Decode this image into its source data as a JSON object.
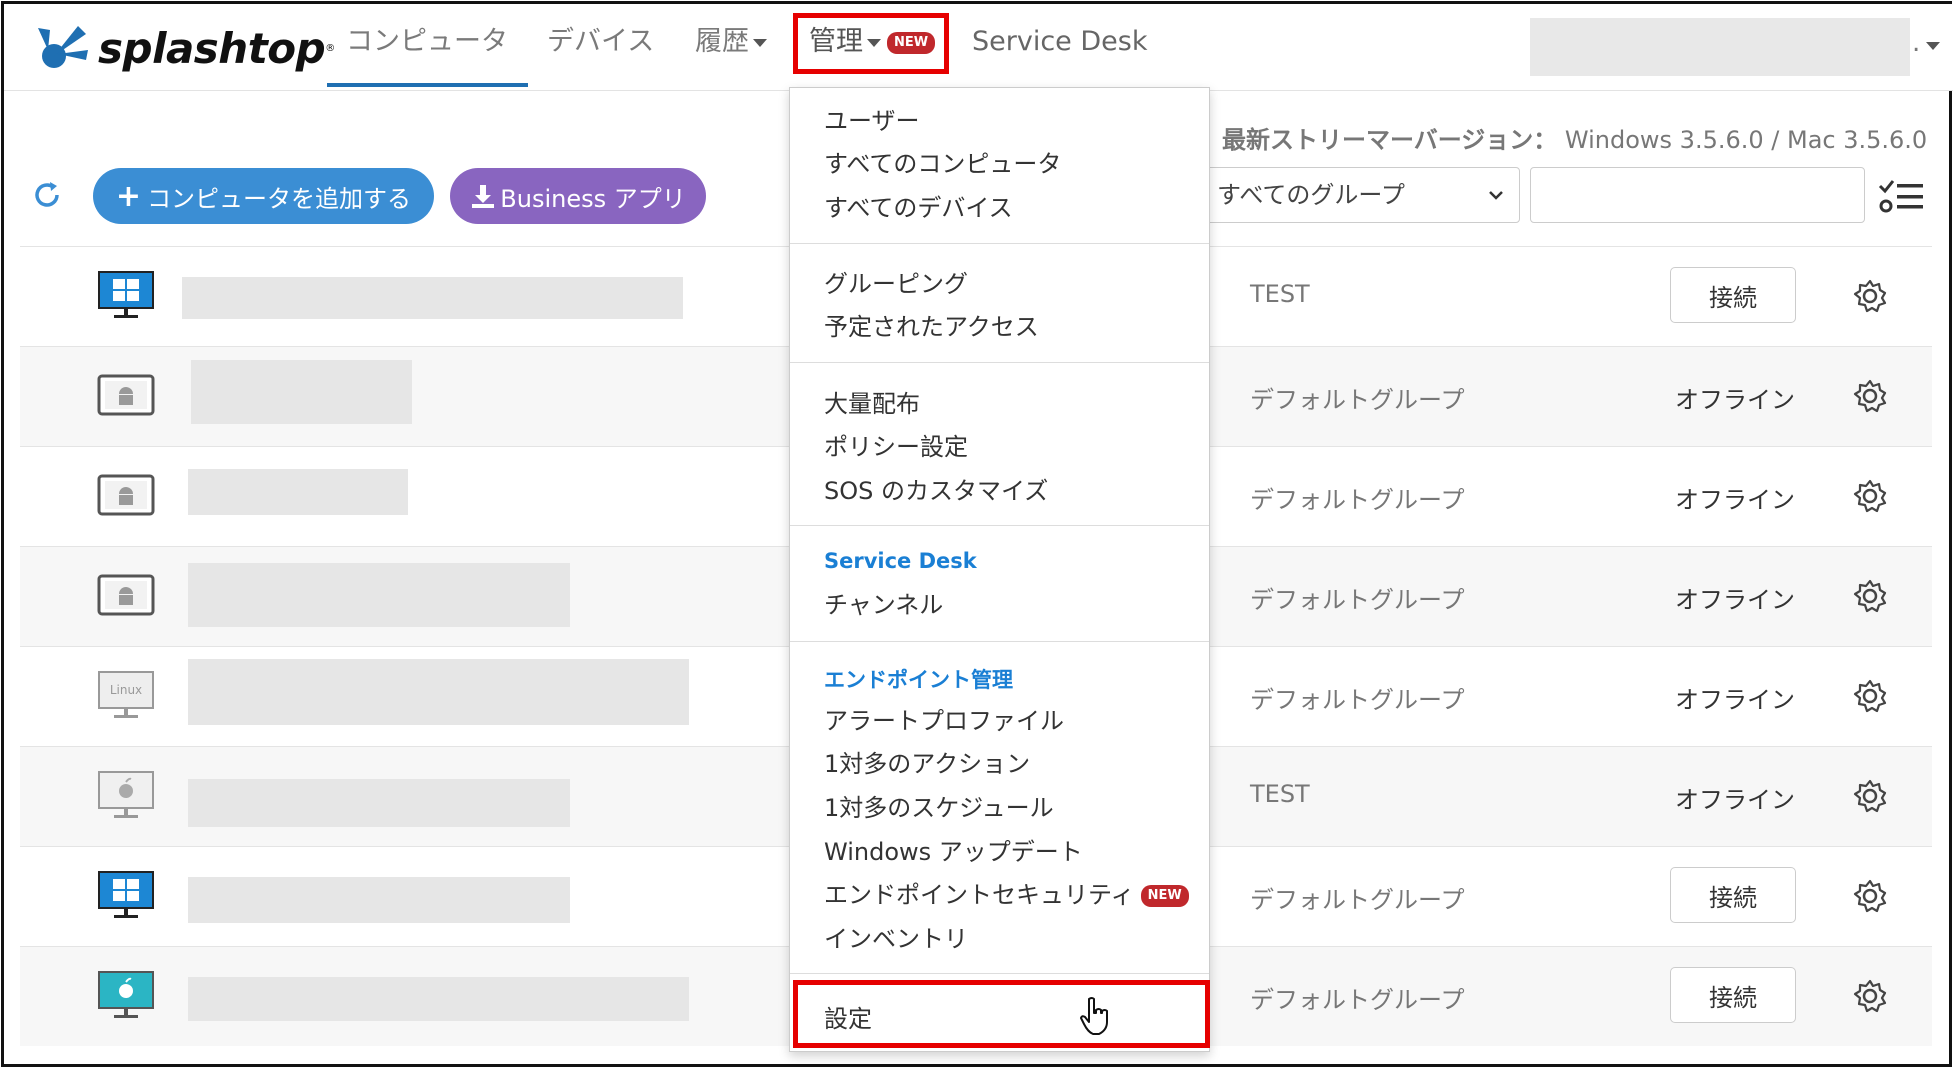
{
  "brand": {
    "name": "splashtop",
    "reg": "®"
  },
  "nav": {
    "computers": "コンピュータ",
    "devices": "デバイス",
    "history": "履歴",
    "management": "管理",
    "new_badge": "NEW",
    "service_desk": "Service Desk",
    "user_suffix": "."
  },
  "toolbar": {
    "add_computer": "コンピュータを追加する",
    "business_app": "Business アプリ",
    "stream_label": "最新ストリーマーバージョン：",
    "stream_versions": "Windows 3.5.6.0 / Mac 3.5.6.0",
    "group_select": "すべてのグループ",
    "search_placeholder": ""
  },
  "rows": [
    {
      "icon": "windows-monitor-icon",
      "group": "TEST",
      "status": "",
      "action": "接続"
    },
    {
      "icon": "android-tablet-icon",
      "group": "デフォルトグループ",
      "status": "オフライン",
      "action": ""
    },
    {
      "icon": "android-tablet-icon",
      "group": "デフォルトグループ",
      "status": "オフライン",
      "action": ""
    },
    {
      "icon": "android-tablet-icon",
      "group": "デフォルトグループ",
      "status": "オフライン",
      "action": ""
    },
    {
      "icon": "linux-monitor-icon",
      "group": "デフォルトグループ",
      "status": "オフライン",
      "action": ""
    },
    {
      "icon": "apple-monitor-icon",
      "group": "TEST",
      "status": "オフライン",
      "action": ""
    },
    {
      "icon": "windows-monitor-icon",
      "group": "デフォルトグループ",
      "status": "",
      "action": "接続"
    },
    {
      "icon": "apple-monitor-color-icon",
      "group": "デフォルトグループ",
      "status": "",
      "action": "接続"
    }
  ],
  "menu": {
    "users": "ユーザー",
    "all_computers": "すべてのコンピュータ",
    "all_devices": "すべてのデバイス",
    "grouping": "グルーピング",
    "scheduled_access": "予定されたアクセス",
    "mass_deploy": "大量配布",
    "policy": "ポリシー設定",
    "sos_custom": "SOS のカスタマイズ",
    "service_desk_head": "Service Desk",
    "channels": "チャンネル",
    "endpoint_head": "エンドポイント管理",
    "alert_profile": "アラートプロファイル",
    "one_many_action": "1対多のアクション",
    "one_many_schedule": "1対多のスケジュール",
    "windows_update": "Windows アップデート",
    "endpoint_security": "エンドポイントセキュリティ",
    "new_badge": "NEW",
    "inventory": "インベントリ",
    "settings": "設定"
  },
  "colors": {
    "accent_blue": "#3b8ed4",
    "accent_purple": "#8965c0",
    "highlight_red": "#e60000",
    "badge_red": "#c0282c",
    "section_blue": "#1a7fd4"
  }
}
